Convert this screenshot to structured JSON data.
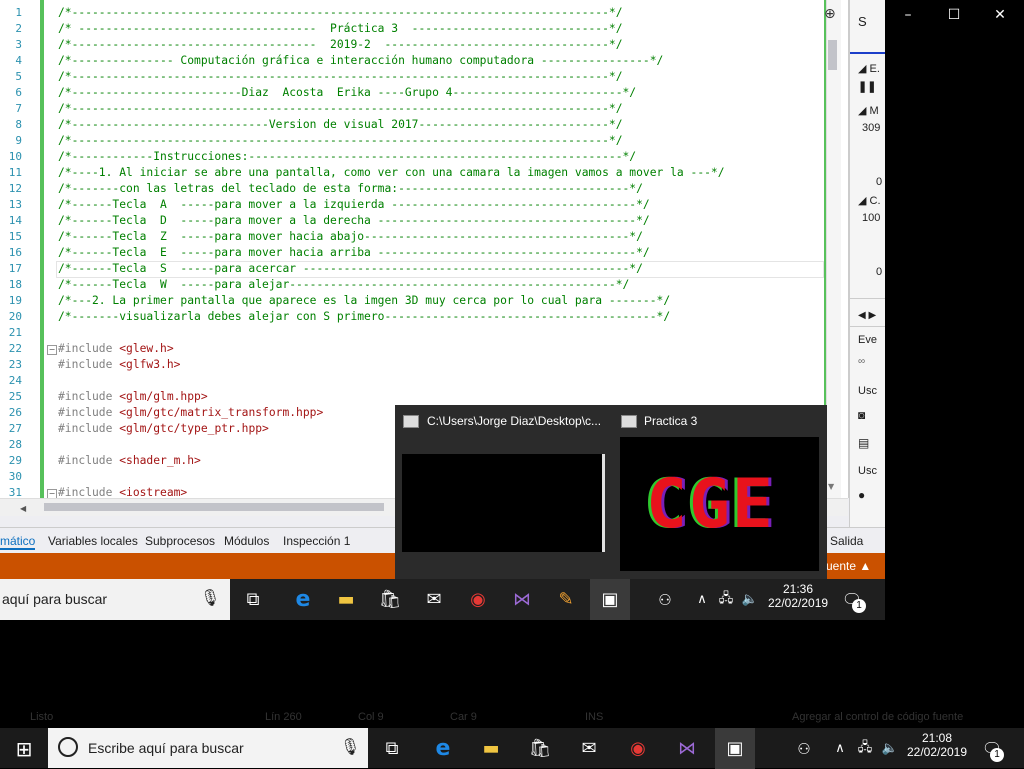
{
  "window_controls": {
    "min": "–",
    "max": "☐",
    "close": "✕"
  },
  "code_lines": [
    {
      "n": "1",
      "t": "/*-------------------------------------------------------------------------------*/",
      "k": "cm"
    },
    {
      "n": "2",
      "t": "/* -----------------------------------  Práctica 3  -----------------------------*/",
      "k": "cm"
    },
    {
      "n": "3",
      "t": "/*------------------------------------  2019-2  ---------------------------------*/",
      "k": "cm"
    },
    {
      "n": "4",
      "t": "/*--------------- Computación gráfica e interacción humano computadora ----------------*/",
      "k": "cm"
    },
    {
      "n": "5",
      "t": "/*-------------------------------------------------------------------------------*/",
      "k": "cm"
    },
    {
      "n": "6",
      "t": "/*-------------------------Diaz  Acosta  Erika ----Grupo 4-------------------------*/",
      "k": "cm"
    },
    {
      "n": "7",
      "t": "/*-------------------------------------------------------------------------------*/",
      "k": "cm"
    },
    {
      "n": "8",
      "t": "/*-----------------------------Version de visual 2017----------------------------*/",
      "k": "cm"
    },
    {
      "n": "9",
      "t": "/*-------------------------------------------------------------------------------*/",
      "k": "cm"
    },
    {
      "n": "10",
      "t": "/*------------Instrucciones:-------------------------------------------------------*/",
      "k": "cm"
    },
    {
      "n": "11",
      "t": "/*----1. Al iniciar se abre una pantalla, como ver con una camara la imagen vamos a mover la ---*/",
      "k": "cm"
    },
    {
      "n": "12",
      "t": "/*-------con las letras del teclado de esta forma:----------------------------------*/",
      "k": "cm"
    },
    {
      "n": "13",
      "t": "/*------Tecla  A  -----para mover a la izquierda ------------------------------------*/",
      "k": "cm"
    },
    {
      "n": "14",
      "t": "/*------Tecla  D  -----para mover a la derecha --------------------------------------*/",
      "k": "cm"
    },
    {
      "n": "15",
      "t": "/*------Tecla  Z  -----para mover hacia abajo---------------------------------------*/",
      "k": "cm"
    },
    {
      "n": "16",
      "t": "/*------Tecla  E  -----para mover hacia arriba --------------------------------------*/",
      "k": "cm"
    },
    {
      "n": "17",
      "t": "/*------Tecla  S  -----para acercar ------------------------------------------------*/",
      "k": "cm"
    },
    {
      "n": "18",
      "t": "/*------Tecla  W  -----para alejar------------------------------------------------*/",
      "k": "cm"
    },
    {
      "n": "19",
      "t": "/*---2. La primer pantalla que aparece es la imgen 3D muy cerca por lo cual para -------*/",
      "k": "cm"
    },
    {
      "n": "20",
      "t": "/*-------visualizarla debes alejar con S primero----------------------------------------*/",
      "k": "cm"
    },
    {
      "n": "21",
      "t": "",
      "k": "cm"
    },
    {
      "n": "22",
      "t": "#include",
      "inc": " <glew.h>",
      "k": "pp"
    },
    {
      "n": "23",
      "t": "#include",
      "inc": " <glfw3.h>",
      "k": "pp"
    },
    {
      "n": "24",
      "t": "",
      "k": "cm"
    },
    {
      "n": "25",
      "t": "#include",
      "inc": " <glm/glm.hpp>",
      "k": "pp"
    },
    {
      "n": "26",
      "t": "#include",
      "inc": " <glm/gtc/matrix_transform.hpp>",
      "k": "pp"
    },
    {
      "n": "27",
      "t": "#include",
      "inc": " <glm/gtc/type_ptr.hpp>",
      "k": "pp"
    },
    {
      "n": "28",
      "t": "",
      "k": "cm"
    },
    {
      "n": "29",
      "t": "#include",
      "inc": " <shader_m.h>",
      "k": "pp"
    },
    {
      "n": "30",
      "t": "",
      "k": "cm"
    },
    {
      "n": "31",
      "t": "#include",
      "inc": " <iostream>",
      "k": "pp"
    }
  ],
  "right_panel": {
    "l1": "S",
    "l2": "E.",
    "l3": "M",
    "l4": "309",
    "l5": "0",
    "l6": "C.",
    "l7": "100",
    "l8": "0",
    "l9": "Eve",
    "l10": "Usc",
    "l11": "Usc"
  },
  "debug_tabs": [
    "mático",
    "Variables locales",
    "Subprocesos",
    "Módulos",
    "Inspección 1"
  ],
  "debug_tab_right": "Salida",
  "status_right": "uente ▲",
  "inner_taskbar": {
    "search_placeholder": "aquí para buscar",
    "time": "21:36",
    "date": "22/02/2019",
    "notif_count": "1"
  },
  "popup": {
    "thumb1_title": "C:\\Users\\Jorge Diaz\\Desktop\\c...",
    "thumb2_title": "Practica 3",
    "thumb2_text": "CGE"
  },
  "outer_status": {
    "a": "Listo",
    "b": "Lín 260",
    "c": "Col 9",
    "d": "Car 9",
    "e": "INS",
    "f": "Agregar al control de código fuente"
  },
  "outer_taskbar": {
    "search_placeholder": "Escribe aquí para buscar",
    "time": "21:08",
    "date": "22/02/2019",
    "notif_count": "1"
  }
}
